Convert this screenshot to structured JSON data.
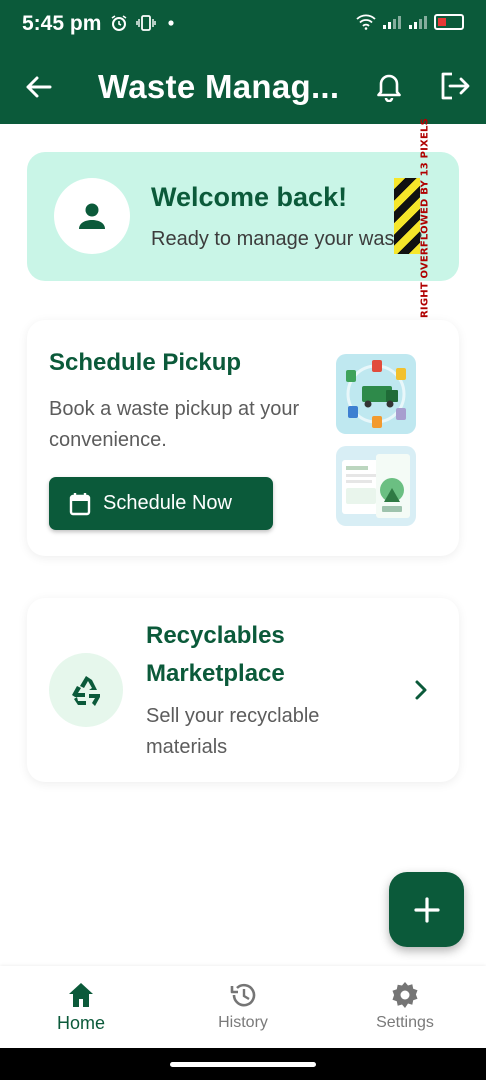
{
  "status_bar": {
    "time": "5:45 pm",
    "icons": [
      "alarm-icon",
      "vibrate-icon",
      "dot-icon",
      "wifi-icon",
      "signal-icon",
      "signal-icon",
      "battery-icon"
    ]
  },
  "app_bar": {
    "title": "Waste Manag...",
    "icons": [
      "back-arrow-icon",
      "bell-icon",
      "logout-icon"
    ]
  },
  "welcome": {
    "title": "Welcome back!",
    "subtitle": "Ready to manage your waste?",
    "overflow_warning": "RIGHT OVERFLOWED BY 13 PIXELS"
  },
  "pickup": {
    "title": "Schedule Pickup",
    "description": "Book a waste pickup at your convenience.",
    "button_label": "Schedule Now"
  },
  "marketplace": {
    "title": "Recyclables Marketplace",
    "description": "Sell your recyclable materials"
  },
  "bottom_nav": {
    "items": [
      {
        "label": "Home",
        "icon": "home-icon",
        "active": true
      },
      {
        "label": "History",
        "icon": "history-icon",
        "active": false
      },
      {
        "label": "Settings",
        "icon": "settings-icon",
        "active": false
      }
    ]
  },
  "colors": {
    "primary": "#0b5a3a",
    "welcome_bg": "#c9f5e7",
    "recycle_bg": "#e6f7ec",
    "overflow_red": "#b00000"
  }
}
